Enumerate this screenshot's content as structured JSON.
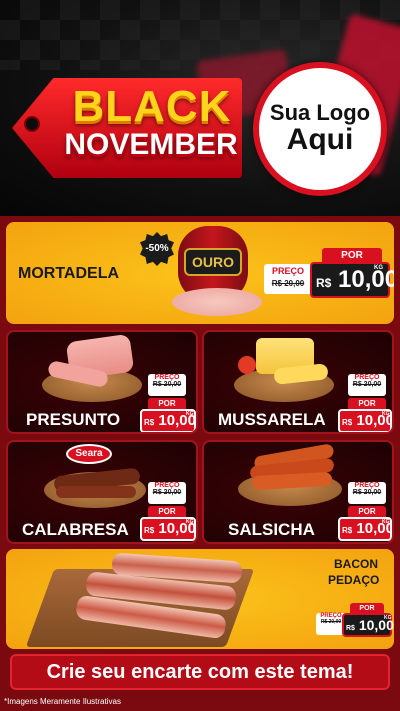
{
  "header": {
    "tag_line1": "BLACK",
    "tag_line2": "NOVEMBER",
    "logo_line1": "Sua Logo",
    "logo_line2": "Aqui"
  },
  "products": [
    {
      "name": "MORTADELA",
      "discount": "-50%",
      "brand": "OURO",
      "preco_label": "PREÇO",
      "old_price": "R$ 20,00",
      "por_label": "POR",
      "currency": "R$",
      "price": "10,00",
      "unit": "KG"
    },
    {
      "name": "PRESUNTO",
      "preco_label": "PREÇO",
      "old_price": "R$ 20,00",
      "por_label": "POR",
      "currency": "R$",
      "price": "10,00",
      "unit": "KG"
    },
    {
      "name": "MUSSARELA",
      "preco_label": "PREÇO",
      "old_price": "R$ 20,00",
      "por_label": "POR",
      "currency": "R$",
      "price": "10,00",
      "unit": "KG"
    },
    {
      "name": "CALABRESA",
      "brand": "Seara",
      "preco_label": "PREÇO",
      "old_price": "R$ 20,00",
      "por_label": "POR",
      "currency": "R$",
      "price": "10,00",
      "unit": "KG"
    },
    {
      "name": "SALSICHA",
      "preco_label": "PREÇO",
      "old_price": "R$ 20,00",
      "por_label": "POR",
      "currency": "R$",
      "price": "10,00",
      "unit": "KG"
    },
    {
      "name_line1": "BACON",
      "name_line2": "PEDAÇO",
      "preco_label": "PREÇO",
      "old_price": "R$ 20,00",
      "por_label": "POR",
      "currency": "R$",
      "price": "10,00",
      "unit": "KG"
    }
  ],
  "cta": "Crie seu encarte com este tema!",
  "footnote": "*Imagens Meramente Ilustrativas",
  "colors": {
    "brand_red": "#d8101f",
    "yellow": "#f3a20f",
    "dark_red": "#7a0a0f"
  }
}
